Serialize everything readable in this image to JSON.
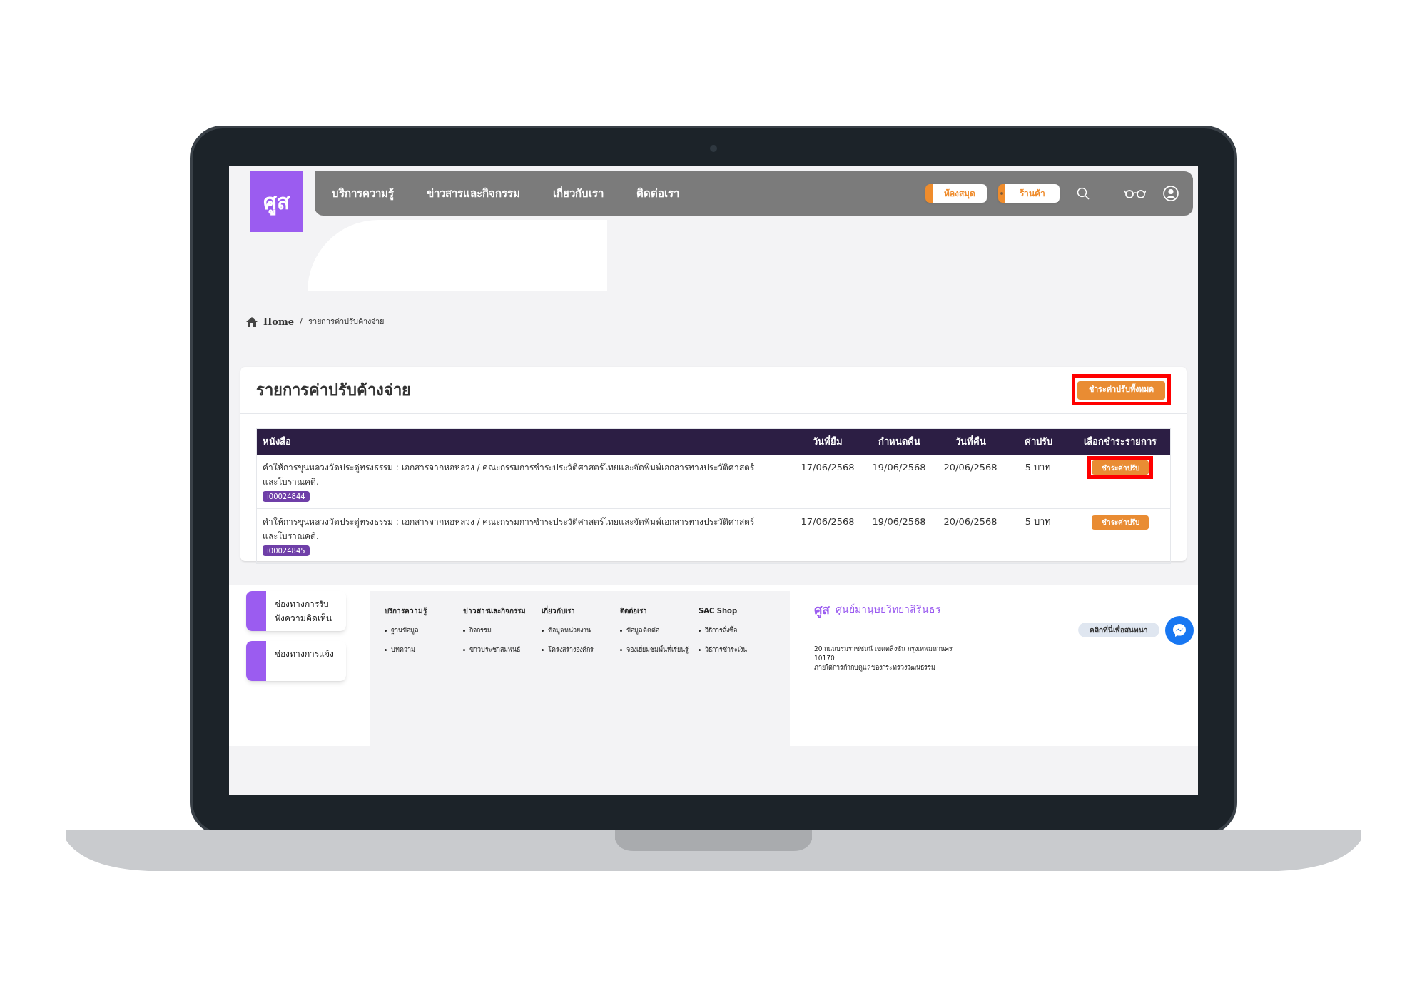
{
  "logo": {
    "text": "ศูส"
  },
  "nav": {
    "items": [
      "บริการความรู้",
      "ข่าวสารและกิจกรรม",
      "เกี่ยวกับเรา",
      "ติดต่อเรา"
    ],
    "buttons": [
      {
        "label": "ห้องสมุด",
        "dot": false
      },
      {
        "label": "ร้านค้า",
        "dot": true
      }
    ]
  },
  "breadcrumb": [
    "Home",
    "/",
    "รายการค่าปรับค้างจ่าย"
  ],
  "card": {
    "title": "รายการค่าปรับค้างจ่าย",
    "pay_all": {
      "label": "ชำระค่าปรับทั้งหมด",
      "highlighted": true
    },
    "table": {
      "columns": [
        "หนังสือ",
        "วันที่ยืม",
        "กำหนดคืน",
        "วันที่คืน",
        "ค่าปรับ",
        "เลือกชำระรายการ"
      ],
      "rows": [
        {
          "title": "คำให้การขุนหลวงวัดประดู่ทรงธรรม : เอกสารจากหอหลวง / คณะกรรมการชำระประวัติศาสตร์ไทยและจัดพิมพ์เอกสารทางประวัติศาสตร์และโบราณคดี.",
          "barcode": "i00024844",
          "borrowed": "17/06/2568",
          "due": "19/06/2568",
          "returned": "20/06/2568",
          "fine": "5 บาท",
          "button": "ชำระค่าปรับ",
          "highlighted": true
        },
        {
          "title": "คำให้การขุนหลวงวัดประดู่ทรงธรรม : เอกสารจากหอหลวง / คณะกรรมการชำระประวัติศาสตร์ไทยและจัดพิมพ์เอกสารทางประวัติศาสตร์และโบราณคดี.",
          "barcode": "i00024845",
          "borrowed": "17/06/2568",
          "due": "19/06/2568",
          "returned": "20/06/2568",
          "fine": "5 บาท",
          "button": "ชำระค่าปรับ",
          "highlighted": false
        }
      ]
    }
  },
  "footer": {
    "side_cards": [
      "ช่องทางการรับฟังความคิดเห็น",
      "ช่องทางการแจ้ง"
    ],
    "columns": [
      {
        "heading": "บริการความรู้",
        "links": [
          "ฐานข้อมูล",
          "บทความ"
        ]
      },
      {
        "heading": "ข่าวสารและกิจกรรม",
        "links": [
          "กิจกรรม",
          "ข่าวประชาสัมพันธ์"
        ]
      },
      {
        "heading": "เกี่ยวกับเรา",
        "links": [
          "ข้อมูลหน่วยงาน",
          "โครงสร้างองค์กร"
        ]
      },
      {
        "heading": "ติดต่อเรา",
        "links": [
          "ข้อมูลติดต่อ",
          "จองเยี่ยมชมพื้นที่เรียนรู้"
        ]
      },
      {
        "heading": "SAC Shop",
        "links": [
          "วิธีการสั่งซื้อ",
          "วิธีการชำระเงิน"
        ]
      }
    ],
    "org": {
      "logo": "ศูส",
      "name": "ศูนย์มานุษยวิทยาสิรินธร",
      "chat": "คลิกที่นี่เพื่อสนทนา",
      "address": [
        "20 ถนนบรมราชชนนี เขตตลิ่งชัน กรุงเทพมหานคร",
        "10170",
        "ภายใต้การกำกับดูแลของกระทรวงวัฒนธรรม"
      ]
    }
  }
}
